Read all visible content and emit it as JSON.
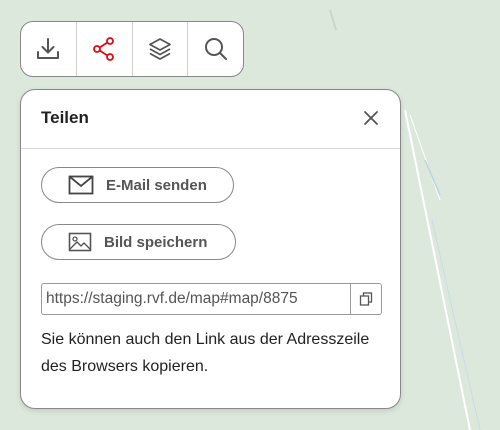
{
  "toolbar": {
    "buttons": [
      {
        "name": "download",
        "icon": "download-icon"
      },
      {
        "name": "share",
        "icon": "share-icon",
        "active": true
      },
      {
        "name": "layers",
        "icon": "layers-icon"
      },
      {
        "name": "search",
        "icon": "search-icon"
      }
    ]
  },
  "share_panel": {
    "title": "Teilen",
    "email_label": "E-Mail senden",
    "image_label": "Bild speichern",
    "link_value": "https://staging.rvf.de/map#map/8875",
    "hint": "Sie können auch den Link aus der Adresszeile des Browsers kopieren."
  },
  "colors": {
    "accent": "#e30613",
    "map_bg": "#dde8dd"
  }
}
